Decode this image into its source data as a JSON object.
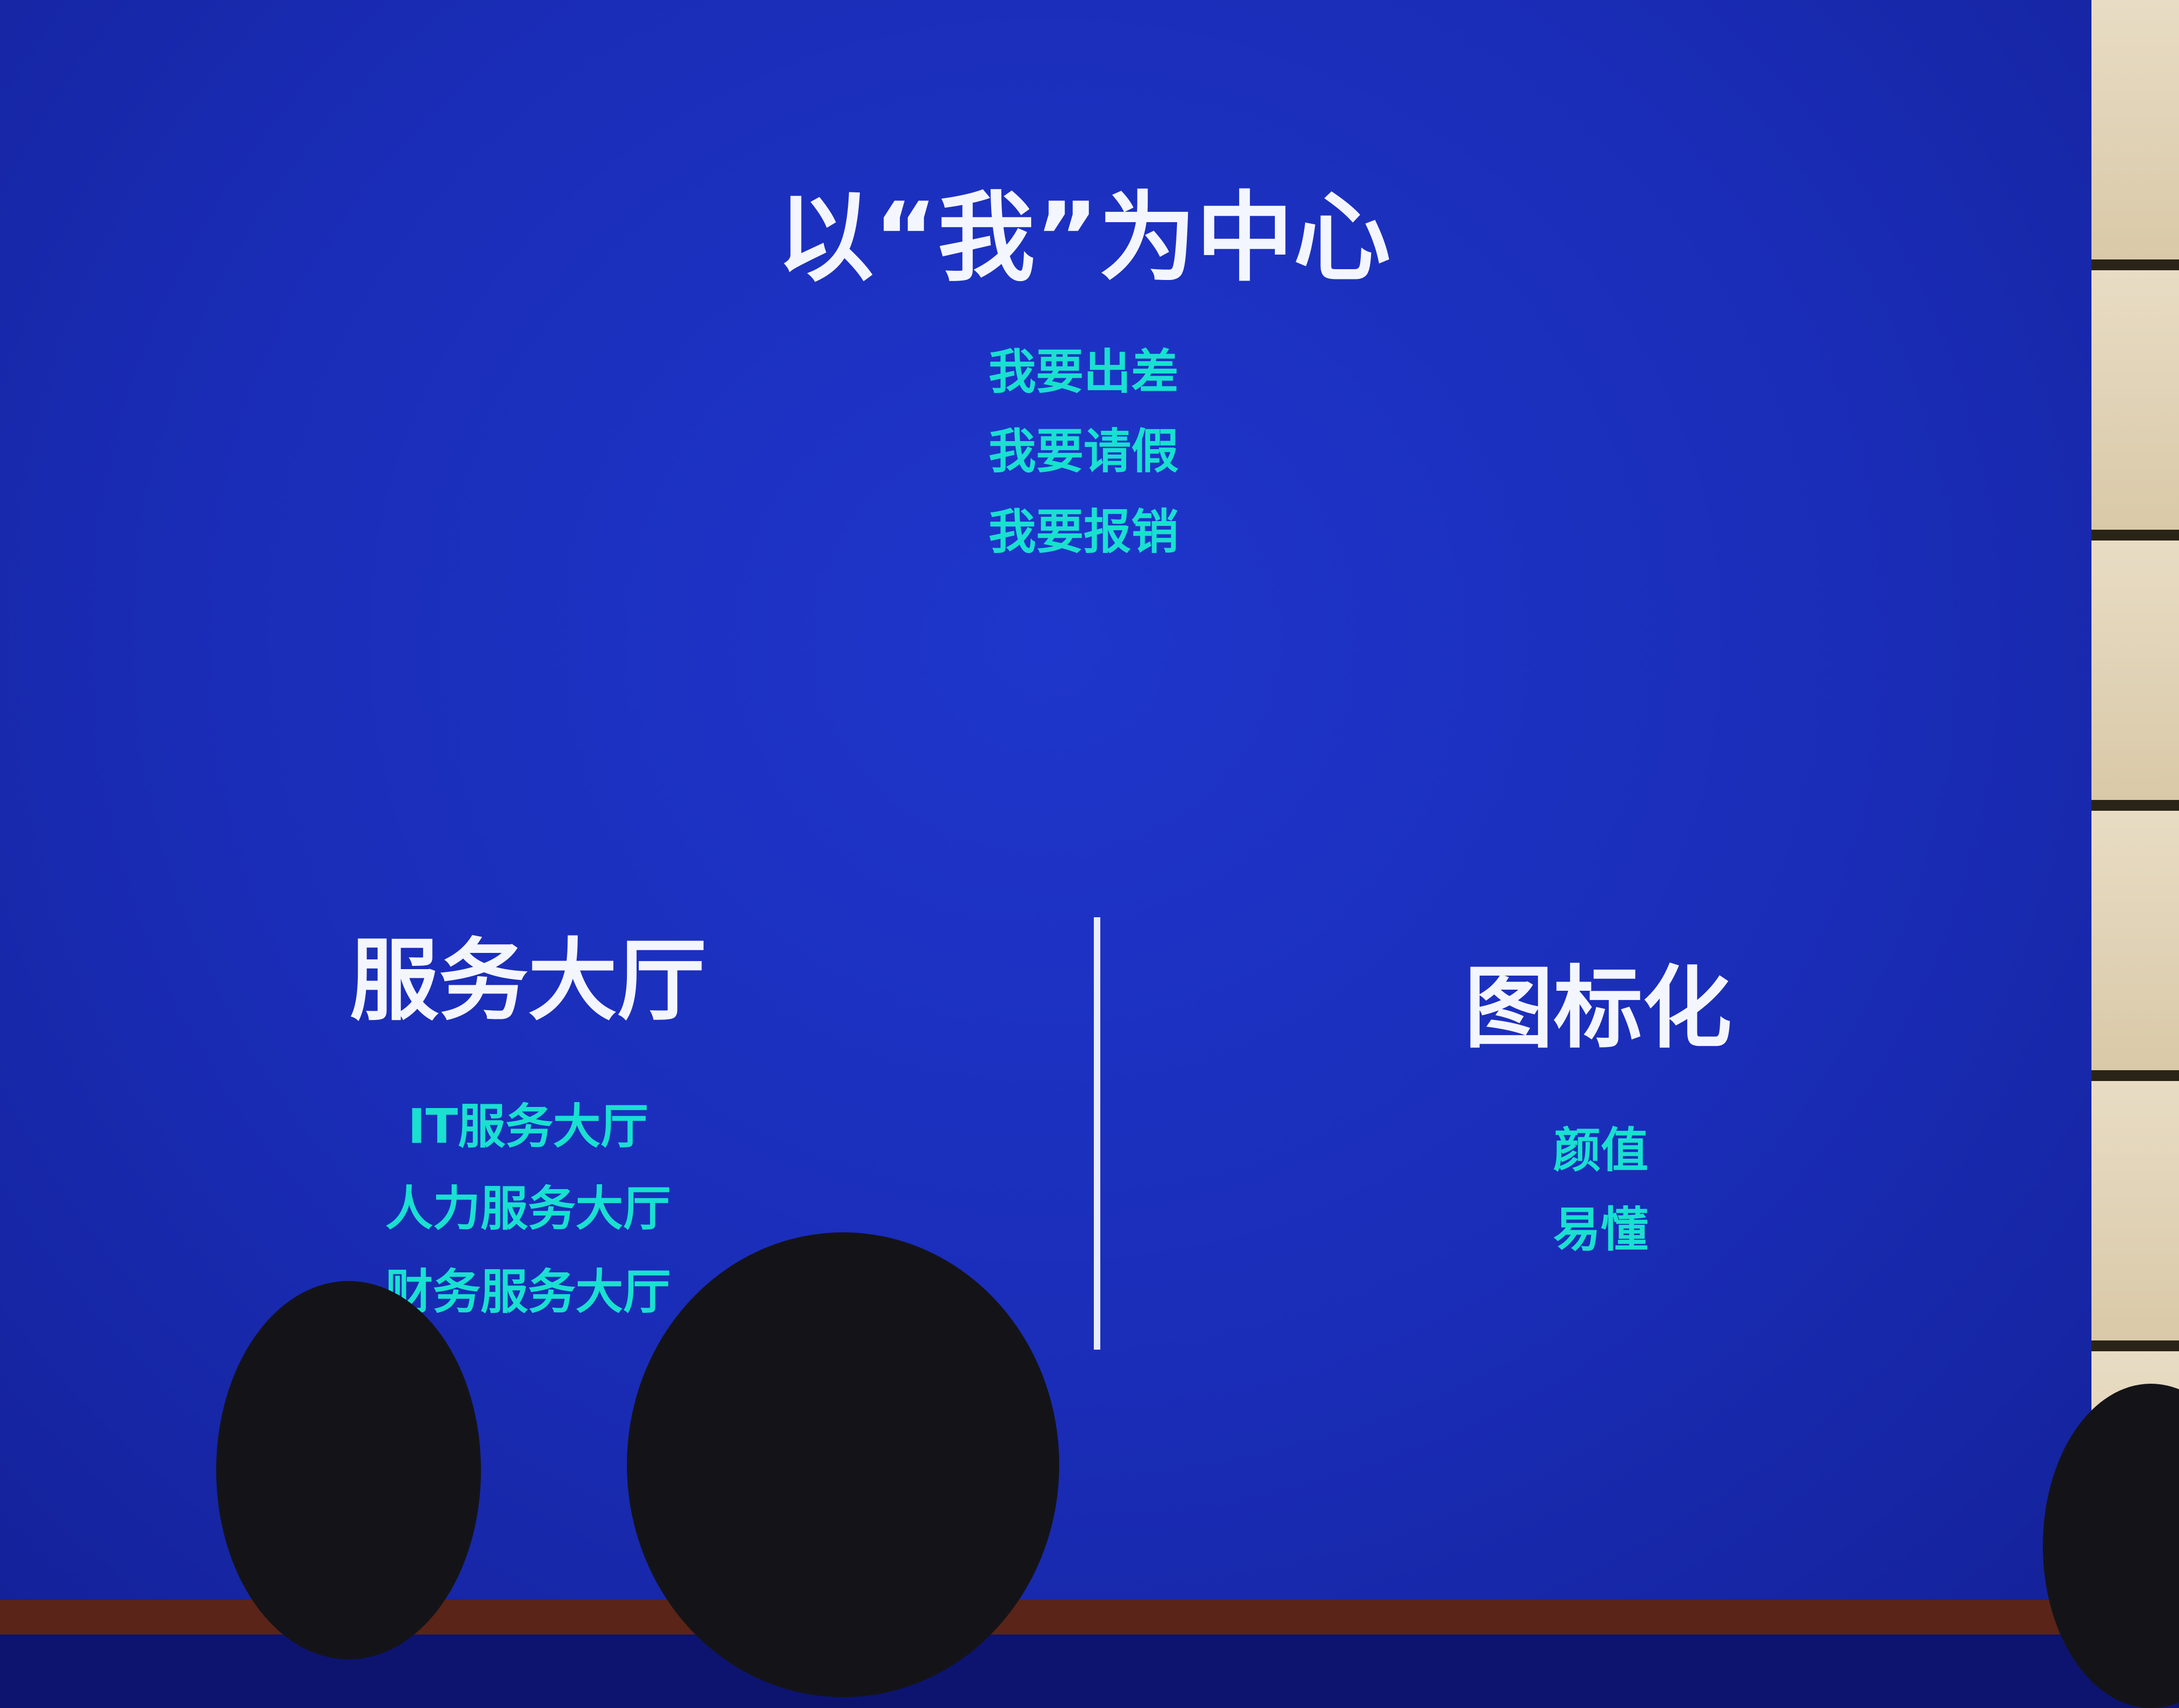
{
  "slide": {
    "title": "以“我”为中心",
    "me_items": [
      "我要出差",
      "我要请假",
      "我要报销"
    ],
    "left_heading": "服务大厅",
    "left_items": [
      "IT服务大厅",
      "人力服务大厅",
      "财务服务大厅"
    ],
    "right_heading": "图标化",
    "right_items": [
      "颜值",
      "易懂"
    ]
  },
  "colors": {
    "screen": "#1a2db8",
    "heading": "#f4f6ff",
    "item": "#19e0d0"
  }
}
